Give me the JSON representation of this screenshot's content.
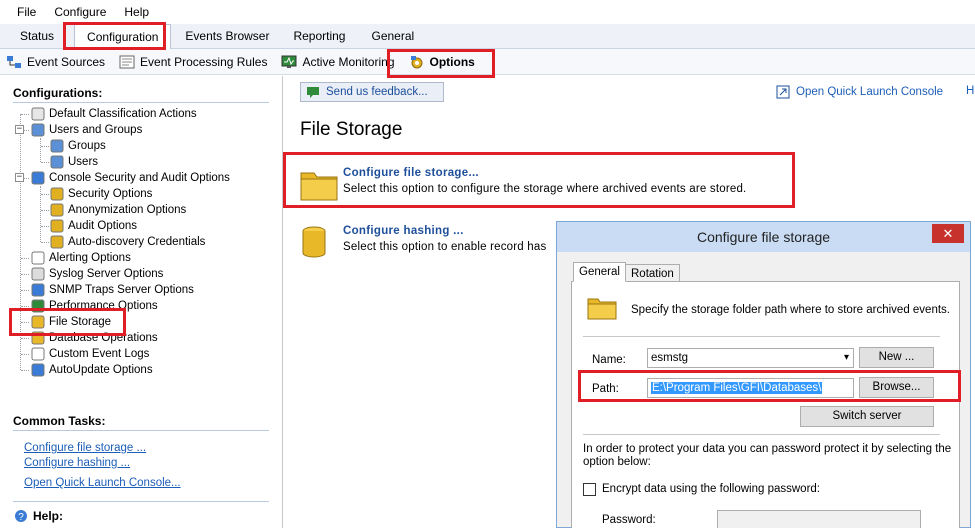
{
  "menu": [
    "File",
    "Configure",
    "Help"
  ],
  "tabs": [
    "Status",
    "Configuration",
    "Events Browser",
    "Reporting",
    "General"
  ],
  "toolbar": [
    "Event Sources",
    "Event Processing Rules",
    "Active Monitoring",
    "Options"
  ],
  "left": {
    "configurations_title": "Configurations:",
    "tree": [
      "Default Classification Actions",
      "Users and Groups",
      "Groups",
      "Users",
      "Console Security and Audit Options",
      "Security Options",
      "Anonymization Options",
      "Audit Options",
      "Auto-discovery Credentials",
      "Alerting Options",
      "Syslog Server Options",
      "SNMP Traps Server Options",
      "Performance Options",
      "File Storage",
      "Database Operations",
      "Custom Event Logs",
      "AutoUpdate Options"
    ],
    "common_tasks_title": "Common Tasks:",
    "tasks": [
      "Configure file storage ...",
      "Configure hashing ...",
      "Open Quick Launch Console..."
    ],
    "help_title": "Help:"
  },
  "content": {
    "feedback": "Send us feedback...",
    "quick_launch": "Open Quick Launch Console",
    "help_short": "H",
    "title": "File Storage",
    "options": [
      {
        "title": "Configure file storage...",
        "desc": "Select this option to configure the storage where archived events are stored."
      },
      {
        "title": "Configure hashing ...",
        "desc": "Select this option to enable record has"
      }
    ]
  },
  "dialog": {
    "title": "Configure file storage",
    "close": "✕",
    "tabs": [
      "General",
      "Rotation"
    ],
    "intro": "Specify the storage folder path where to store archived events.",
    "name_label": "Name:",
    "name_value": "esmstg",
    "new_button": "New ...",
    "path_label": "Path:",
    "path_value": "E:\\Program Files\\GFI\\Databases\\",
    "browse_button": "Browse...",
    "switch_button": "Switch server",
    "protect_text_1": "In order to protect your data you can password protect it by selecting the",
    "protect_text_2": "option below:",
    "encrypt_label": "Encrypt data using the following password:",
    "password_label": "Password:"
  },
  "colors": {
    "highlight": "#e01e26",
    "link": "#1d5eb8",
    "dialog_title_bg": "#c9dcf4"
  }
}
